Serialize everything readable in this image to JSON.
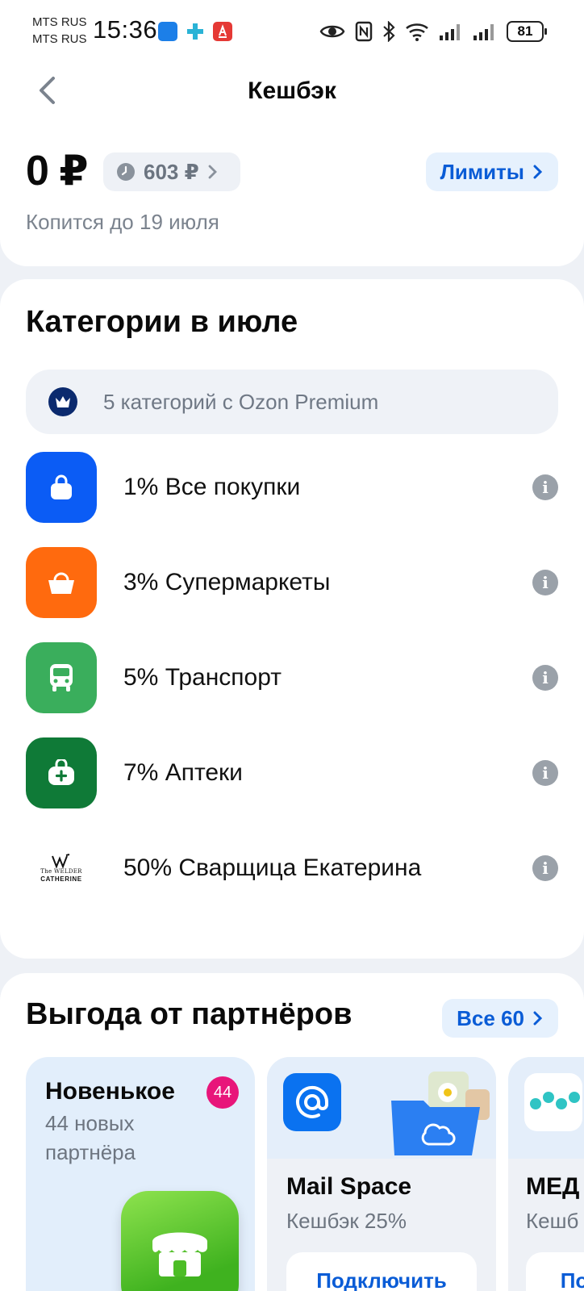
{
  "status_bar": {
    "carrier_1": "MTS RUS",
    "carrier_2": "MTS RUS",
    "time": "15:36",
    "battery": "81",
    "icons": [
      "eye-icon",
      "nfc-icon",
      "bluetooth-icon",
      "wifi-icon",
      "signal-icon",
      "signal-icon"
    ]
  },
  "header": {
    "title": "Кешбэк",
    "back_icon": "chevron-left-icon"
  },
  "balance": {
    "amount": "0 ₽",
    "pending": "603 ₽",
    "limits_label": "Лимиты",
    "accrue_text": "Копится до 19 июля"
  },
  "categories": {
    "title": "Категории в июле",
    "premium_text": "5 категорий с Ozon Premium",
    "items": [
      {
        "label": "1% Все покупки",
        "icon": "shopping-bag-icon",
        "color": "#0b5cf5"
      },
      {
        "label": "3% Супермаркеты",
        "icon": "basket-icon",
        "color": "#ff6a0e"
      },
      {
        "label": "5% Транспорт",
        "icon": "bus-icon",
        "color": "#3aae5c"
      },
      {
        "label": "7% Аптеки",
        "icon": "medkit-icon",
        "color": "#0f7a37"
      },
      {
        "label": "50% Сварщица Екатерина",
        "icon": "brand-logo",
        "logo_top": "The WELDER",
        "logo_bottom": "CATHERINE"
      }
    ]
  },
  "partners": {
    "title": "Выгода от партнёров",
    "all_label": "Все 60",
    "cards": [
      {
        "name": "Новенькое",
        "subtitle": "44 новых партнёра",
        "badge": "44"
      },
      {
        "name": "Mail Space",
        "subtitle": "Кешбэк 25%",
        "button": "Подключить"
      },
      {
        "name": "МЕД",
        "subtitle": "Кешб",
        "button": "По"
      }
    ]
  },
  "colors": {
    "accent": "#0a5cd6",
    "accent_bg": "#e6f1fd",
    "badge": "#e8157a"
  }
}
